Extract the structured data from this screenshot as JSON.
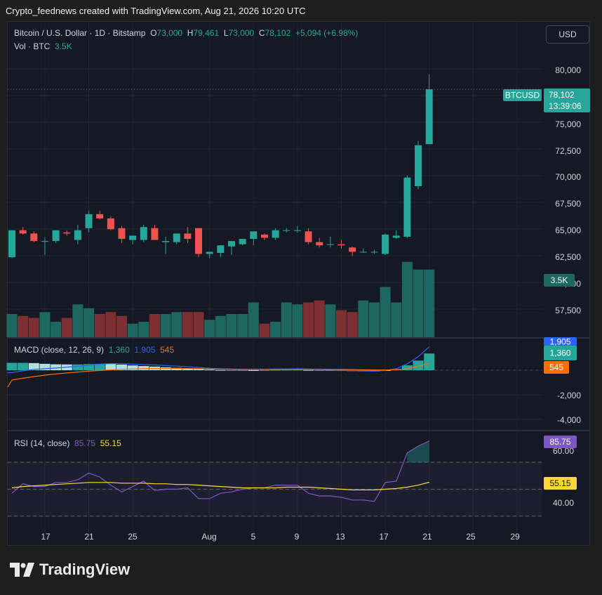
{
  "caption": "Crypto_feednews created with TradingView.com, Aug 21, 2026 10:20 UTC",
  "header": {
    "title": "Bitcoin / U.S. Dollar · 1D · Bitstamp",
    "o_label": "O",
    "o_value": "73,000",
    "h_label": "H",
    "h_value": "79,461",
    "l_label": "L",
    "l_value": "73,000",
    "c_label": "C",
    "c_value": "78,102",
    "change": "+5,094 (+6.98%)",
    "vol_label": "Vol · BTC",
    "vol_value": "3.5K",
    "currency_button": "USD"
  },
  "badges": {
    "symbol": "BTCUSD",
    "price": "78,102",
    "countdown": "13:39:06",
    "volume": "3.5K",
    "macd_signal": "1,905",
    "macd_line": "1,360",
    "macd_hist": "545",
    "rsi": "85.75",
    "rsi_ma": "55.15"
  },
  "macd_legend": {
    "label": "MACD (close, 12, 26, 9)",
    "v1": "1,360",
    "v2": "1,905",
    "v3": "545"
  },
  "rsi_legend": {
    "label": "RSI (14, close)",
    "v1": "85.75",
    "v2": "55.15"
  },
  "brand": {
    "name": "TradingView"
  },
  "colors": {
    "up": "#26a69a",
    "down": "#ef5350",
    "macd_blue": "#2962ff",
    "signal_orange": "#ff6d00",
    "rsi_purple": "#7e57c2",
    "rsi_ma_yellow": "#fdd835"
  },
  "chart_data": [
    {
      "type": "candlestick",
      "title": "Bitcoin / U.S. Dollar · 1D · Bitstamp",
      "x": [
        "Jul 14",
        "Jul 15",
        "Jul 16",
        "Jul 17",
        "Jul 18",
        "Jul 19",
        "Jul 20",
        "Jul 21",
        "Jul 22",
        "Jul 23",
        "Jul 24",
        "Jul 25",
        "Jul 26",
        "Jul 27",
        "Jul 28",
        "Jul 29",
        "Jul 30",
        "Jul 31",
        "Aug 1",
        "Aug 2",
        "Aug 3",
        "Aug 4",
        "Aug 5",
        "Aug 6",
        "Aug 7",
        "Aug 8",
        "Aug 9",
        "Aug 10",
        "Aug 11",
        "Aug 12",
        "Aug 13",
        "Aug 14",
        "Aug 15",
        "Aug 16",
        "Aug 17",
        "Aug 18",
        "Aug 19",
        "Aug 20",
        "Aug 21"
      ],
      "ohlc": [
        [
          62500,
          65000,
          62400,
          65000
        ],
        [
          65000,
          65300,
          64600,
          64700
        ],
        [
          64700,
          64900,
          63900,
          64000
        ],
        [
          64000,
          64300,
          62700,
          64000
        ],
        [
          64000,
          65000,
          63800,
          65000
        ],
        [
          64800,
          65000,
          64500,
          64700
        ],
        [
          64100,
          65500,
          63700,
          65000
        ],
        [
          65200,
          66800,
          64800,
          66500
        ],
        [
          66500,
          66800,
          66000,
          66100
        ],
        [
          66100,
          66300,
          65000,
          65100
        ],
        [
          65200,
          65400,
          63800,
          64200
        ],
        [
          64100,
          64500,
          63700,
          64500
        ],
        [
          64100,
          65500,
          63900,
          65300
        ],
        [
          65200,
          65500,
          64100,
          64100
        ],
        [
          63900,
          64400,
          62800,
          64000
        ],
        [
          63900,
          64700,
          63700,
          64700
        ],
        [
          64700,
          65300,
          63800,
          64200
        ],
        [
          65200,
          65200,
          62500,
          62800
        ],
        [
          62800,
          63000,
          62400,
          63000
        ],
        [
          62900,
          63600,
          62500,
          63600
        ],
        [
          63500,
          64000,
          62700,
          64000
        ],
        [
          63700,
          64200,
          63600,
          64200
        ],
        [
          64200,
          64900,
          63600,
          64900
        ],
        [
          64600,
          64700,
          64100,
          64300
        ],
        [
          64300,
          65200,
          64100,
          65000
        ],
        [
          65000,
          65200,
          64800,
          65000
        ],
        [
          65000,
          65400,
          64800,
          65000
        ],
        [
          64900,
          65200,
          63700,
          63900
        ],
        [
          63900,
          64300,
          63400,
          63600
        ],
        [
          63700,
          64400,
          63400,
          63700
        ],
        [
          63700,
          64100,
          63300,
          63600
        ],
        [
          63400,
          63500,
          62600,
          63000
        ],
        [
          63000,
          63300,
          62900,
          63000
        ],
        [
          63000,
          63200,
          62800,
          63000
        ],
        [
          62800,
          64700,
          62700,
          64600
        ],
        [
          64300,
          65000,
          64200,
          64500
        ],
        [
          64400,
          70100,
          64300,
          69900
        ],
        [
          69100,
          73300,
          68800,
          72900
        ],
        [
          73000,
          79461,
          73000,
          78102
        ]
      ],
      "volume": [
        1200,
        1100,
        1000,
        1300,
        800,
        1000,
        1700,
        1500,
        1200,
        1300,
        1100,
        700,
        800,
        1200,
        1200,
        1300,
        1300,
        1300,
        900,
        1100,
        1200,
        1200,
        1800,
        700,
        800,
        1800,
        1700,
        1800,
        1900,
        1700,
        1400,
        1300,
        1900,
        1800,
        2600,
        1800,
        3900,
        3500,
        3500
      ],
      "ylim": [
        55000,
        82000
      ],
      "yticks": [
        "80,000",
        "75,000",
        "72,500",
        "70,000",
        "67,500",
        "65,000",
        "62,500",
        "60,000",
        "57,500"
      ],
      "xticks": [
        "17",
        "21",
        "25",
        "Aug",
        "5",
        "9",
        "13",
        "17",
        "21",
        "25",
        "29"
      ]
    },
    {
      "type": "line",
      "title": "MACD (close, 12, 26, 9)",
      "series": [
        {
          "name": "MACD",
          "values": [
            -200,
            -50,
            60,
            120,
            180,
            250,
            320,
            420,
            500,
            540,
            530,
            490,
            460,
            430,
            380,
            330,
            280,
            230,
            160,
            110,
            80,
            60,
            60,
            70,
            90,
            100,
            110,
            90,
            60,
            30,
            0,
            -30,
            -60,
            -80,
            -20,
            120,
            520,
            1100,
            1905
          ]
        },
        {
          "name": "Signal",
          "values": [
            -800,
            -650,
            -520,
            -400,
            -300,
            -220,
            -150,
            -80,
            -20,
            30,
            70,
            100,
            120,
            135,
            140,
            140,
            135,
            125,
            110,
            95,
            85,
            75,
            70,
            68,
            70,
            72,
            75,
            76,
            74,
            68,
            60,
            50,
            38,
            25,
            18,
            30,
            120,
            320,
            545
          ]
        },
        {
          "name": "Histogram",
          "values": [
            600,
            600,
            580,
            520,
            480,
            470,
            470,
            500,
            520,
            510,
            460,
            390,
            340,
            295,
            240,
            190,
            145,
            105,
            50,
            15,
            -5,
            -15,
            -10,
            2,
            20,
            28,
            35,
            14,
            -14,
            -38,
            -60,
            -80,
            -98,
            -105,
            -38,
            90,
            400,
            780,
            1360
          ]
        }
      ],
      "yticks": [
        "-2,000",
        "-4,000"
      ]
    },
    {
      "type": "line",
      "title": "RSI (14, close)",
      "series": [
        {
          "name": "RSI",
          "values": [
            47,
            54,
            52,
            52,
            55,
            55,
            57,
            62,
            59,
            53,
            48,
            52,
            56,
            49,
            50,
            50,
            51,
            43,
            43,
            47,
            48,
            50,
            51,
            51,
            53,
            53,
            53,
            47,
            45,
            45,
            44,
            42,
            42,
            41,
            55,
            56,
            77,
            82,
            85.75
          ]
        },
        {
          "name": "RSI MA",
          "values": [
            51,
            52,
            52.5,
            53,
            53.5,
            54,
            54.5,
            55,
            55,
            55,
            54.5,
            54.5,
            54.5,
            54,
            54,
            53.5,
            53.5,
            53,
            52.5,
            52,
            51.5,
            51,
            51,
            51,
            51,
            51.5,
            51.5,
            51.5,
            51,
            50.5,
            50,
            49.5,
            49.5,
            49.5,
            50,
            50.5,
            51.5,
            53,
            55.15
          ]
        }
      ],
      "yticks": [
        "60.00",
        "40.00"
      ]
    }
  ]
}
